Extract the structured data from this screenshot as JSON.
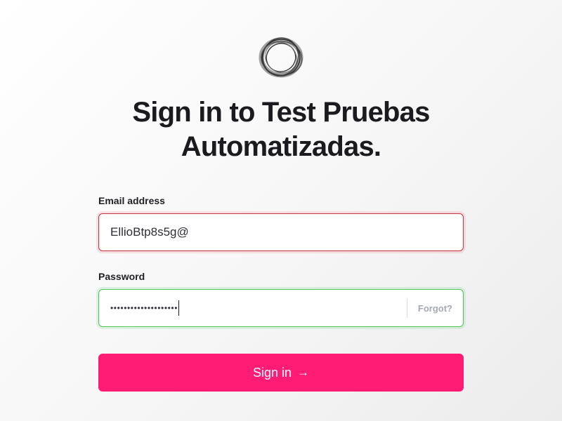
{
  "logo": {
    "icon": "ring-logo-icon"
  },
  "heading": {
    "line1": "Sign in to Test Pruebas",
    "line2": "Automatizadas."
  },
  "email": {
    "label": "Email address",
    "value": "EllioBtp8s5g@",
    "state_color": "#c8343f"
  },
  "password": {
    "label": "Password",
    "masked_value": "••••••••••••••••••••",
    "forgot_label": "Forgot?",
    "state_color": "#4cc55a"
  },
  "submit": {
    "label": "Sign in",
    "arrow": "→",
    "color": "#ff1c74"
  }
}
